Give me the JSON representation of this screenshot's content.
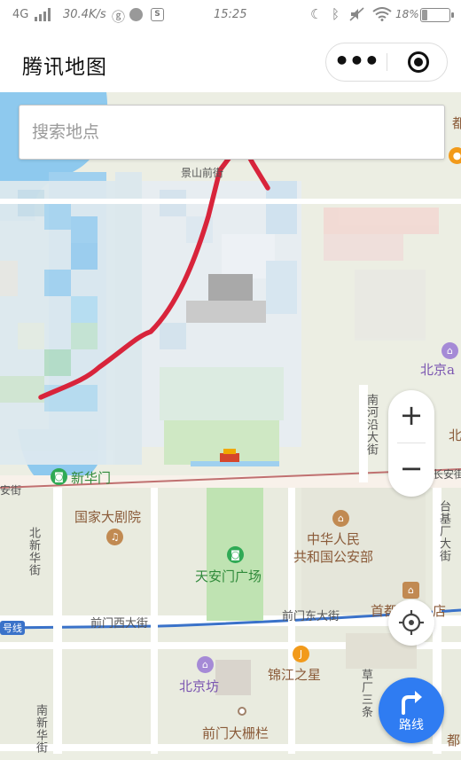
{
  "status_bar": {
    "network": "4G",
    "speed": "30.4K/s",
    "time": "15:25",
    "battery": "18%",
    "battery_level": 0.18
  },
  "header": {
    "title": "腾讯地图",
    "more_label": "•••"
  },
  "search": {
    "placeholder": "搜索地点"
  },
  "map": {
    "labels": {
      "xinhuamen": "新华门",
      "national_theatre": "国家大剧院",
      "tiananmen_square": "天安门广场",
      "ministry_public_security": "中华人民\n共和国公安部",
      "nanheyan_street": "南河沿大街",
      "taijichang_street": "台基厂大街",
      "beixinhua_street": "北新华街",
      "qianmen_west": "前门西大街",
      "qianmen_east": "前门东大街",
      "beijing_fang": "北京坊",
      "jinjiang": "锦江之星",
      "caochang_santiao": "草厂三条",
      "qianmen_dashilan": "前门大栅栏",
      "nanxinhua_street": "南新华街",
      "beijing_a": "北京a",
      "shoudu_hotel": "首都",
      "hotel_suffix": "店",
      "changan_left": "安街",
      "changan_right": "长安街",
      "line_tag": "号线",
      "right_edge_top": "都",
      "right_edge_mid": "北",
      "right_edge_bottom": "都",
      "top_fragment": "景山前街"
    }
  },
  "controls": {
    "zoom_in": "+",
    "zoom_out": "−",
    "route_label": "路线"
  },
  "colors": {
    "accent": "#2f7cf2",
    "annotation_red": "#d8243b",
    "water": "#8ec9ee",
    "park": "#bfe3b2"
  }
}
